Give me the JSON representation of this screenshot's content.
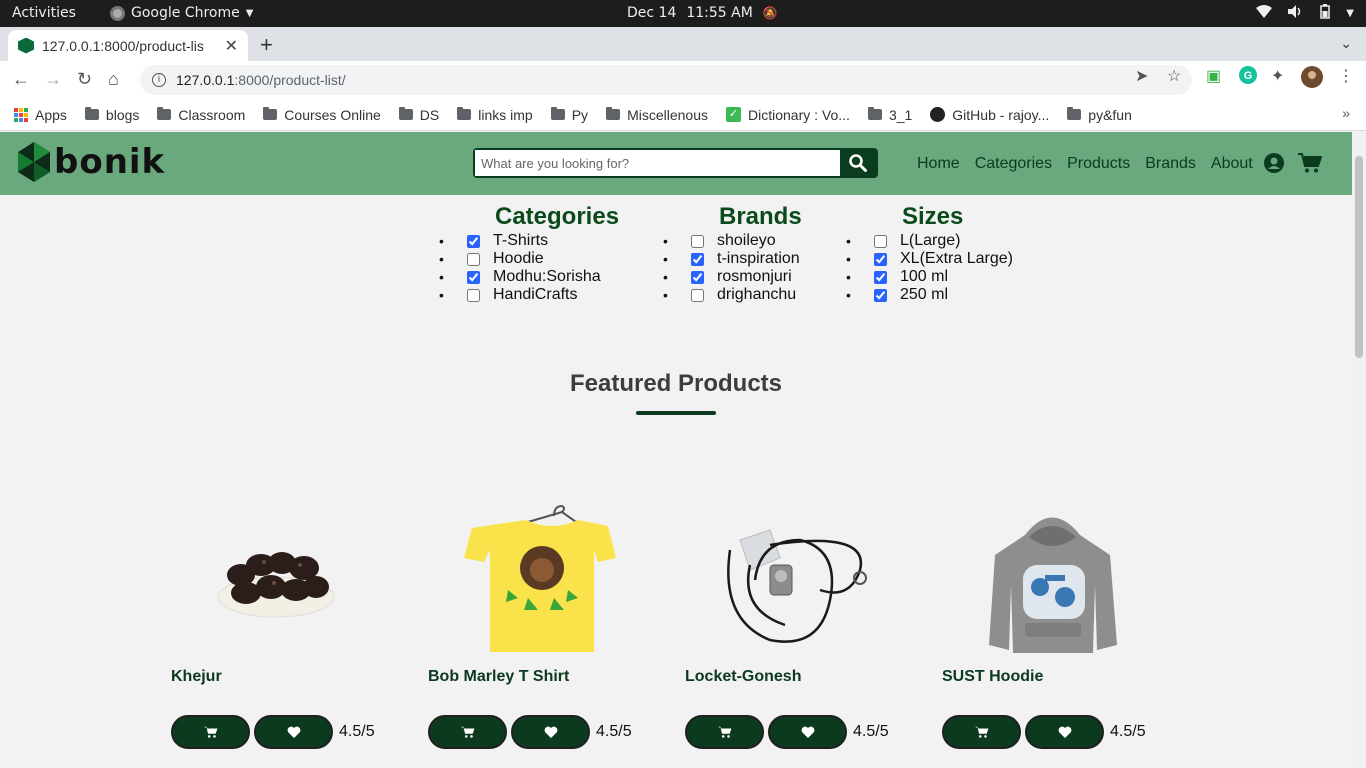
{
  "system": {
    "activities": "Activities",
    "app_name": "Google Chrome",
    "date": "Dec 14",
    "time": "11:55 AM"
  },
  "browser": {
    "tab_title": "127.0.0.1:8000/product-lis",
    "url_host": "127.0.0.1",
    "url_rest": ":8000/product-list/",
    "bookmarks": [
      {
        "label": "Apps",
        "icon": "apps-grid-icon"
      },
      {
        "label": "blogs",
        "icon": "folder-icon"
      },
      {
        "label": "Classroom",
        "icon": "folder-icon"
      },
      {
        "label": "Courses Online",
        "icon": "folder-icon"
      },
      {
        "label": "DS",
        "icon": "folder-icon"
      },
      {
        "label": "links imp",
        "icon": "folder-icon"
      },
      {
        "label": "Py",
        "icon": "folder-icon"
      },
      {
        "label": "Miscellenous",
        "icon": "folder-icon"
      },
      {
        "label": "Dictionary : Vo...",
        "icon": "check-icon"
      },
      {
        "label": "3_1",
        "icon": "folder-icon"
      },
      {
        "label": "GitHub - rajoy...",
        "icon": "github-icon"
      },
      {
        "label": "py&fun",
        "icon": "folder-icon"
      }
    ]
  },
  "site": {
    "logo_text": "bonik",
    "search_placeholder": "What are you looking for?",
    "menu": [
      "Home",
      "Categories",
      "Products",
      "Brands",
      "About"
    ],
    "colors": {
      "nav_bg": "#6aa97e",
      "primary": "#0b3a1e",
      "heading": "#0b4a1b"
    }
  },
  "filters": {
    "categories": {
      "title": "Categories",
      "items": [
        {
          "label": "T-Shirts",
          "checked": true
        },
        {
          "label": "Hoodie",
          "checked": false
        },
        {
          "label": "Modhu:Sorisha",
          "checked": true
        },
        {
          "label": "HandiCrafts",
          "checked": false
        }
      ]
    },
    "brands": {
      "title": "Brands",
      "items": [
        {
          "label": "shoileyo",
          "checked": false
        },
        {
          "label": "t-inspiration",
          "checked": true
        },
        {
          "label": "rosmonjuri",
          "checked": true
        },
        {
          "label": "drighanchu",
          "checked": false
        }
      ]
    },
    "sizes": {
      "title": "Sizes",
      "items": [
        {
          "label": "L(Large)",
          "checked": false
        },
        {
          "label": "XL(Extra Large)",
          "checked": true
        },
        {
          "label": "100 ml",
          "checked": true
        },
        {
          "label": "250 ml",
          "checked": true
        }
      ]
    }
  },
  "featured": {
    "title": "Featured Products",
    "products": [
      {
        "name": "Khejur",
        "rating": "4.5/5"
      },
      {
        "name": "Bob Marley T Shirt",
        "rating": "4.5/5"
      },
      {
        "name": "Locket-Gonesh",
        "rating": "4.5/5"
      },
      {
        "name": "SUST Hoodie",
        "rating": "4.5/5"
      }
    ]
  }
}
